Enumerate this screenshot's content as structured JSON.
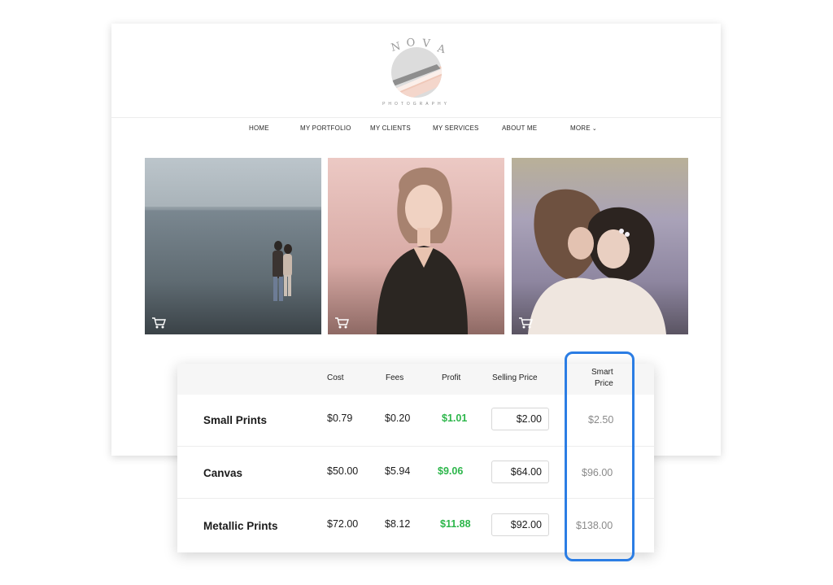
{
  "brand": {
    "name": "NOVA",
    "tagline": "PHOTOGRAPHY"
  },
  "nav": {
    "items": [
      "HOME",
      "MY PORTFOLIO",
      "MY CLIENTS",
      "MY SERVICES",
      "ABOUT ME",
      "MORE"
    ],
    "more_icon": "chevron-down-icon"
  },
  "gallery": {
    "photos": [
      "couple-beach-photo",
      "portrait-woman-photo",
      "couple-lavender-photo"
    ],
    "cart_icon": "cart-icon"
  },
  "pricing": {
    "headers": {
      "cost": "Cost",
      "fees": "Fees",
      "profit": "Profit",
      "selling_price": "Selling Price",
      "smart_price_line1": "Smart",
      "smart_price_line2": "Price"
    },
    "rows": [
      {
        "name": "Small Prints",
        "cost": "$0.79",
        "fees": "$0.20",
        "profit": "$1.01",
        "selling_price": "$2.00",
        "smart_price": "$2.50"
      },
      {
        "name": "Canvas",
        "cost": "$50.00",
        "fees": "$5.94",
        "profit": "$9.06",
        "selling_price": "$64.00",
        "smart_price": "$96.00"
      },
      {
        "name": "Metallic Prints",
        "cost": "$72.00",
        "fees": "$8.12",
        "profit": "$11.88",
        "selling_price": "$92.00",
        "smart_price": "$138.00"
      }
    ]
  },
  "colors": {
    "profit": "#2cb64a",
    "highlight": "#2b7de4",
    "smart_price": "#8a8a8a"
  }
}
